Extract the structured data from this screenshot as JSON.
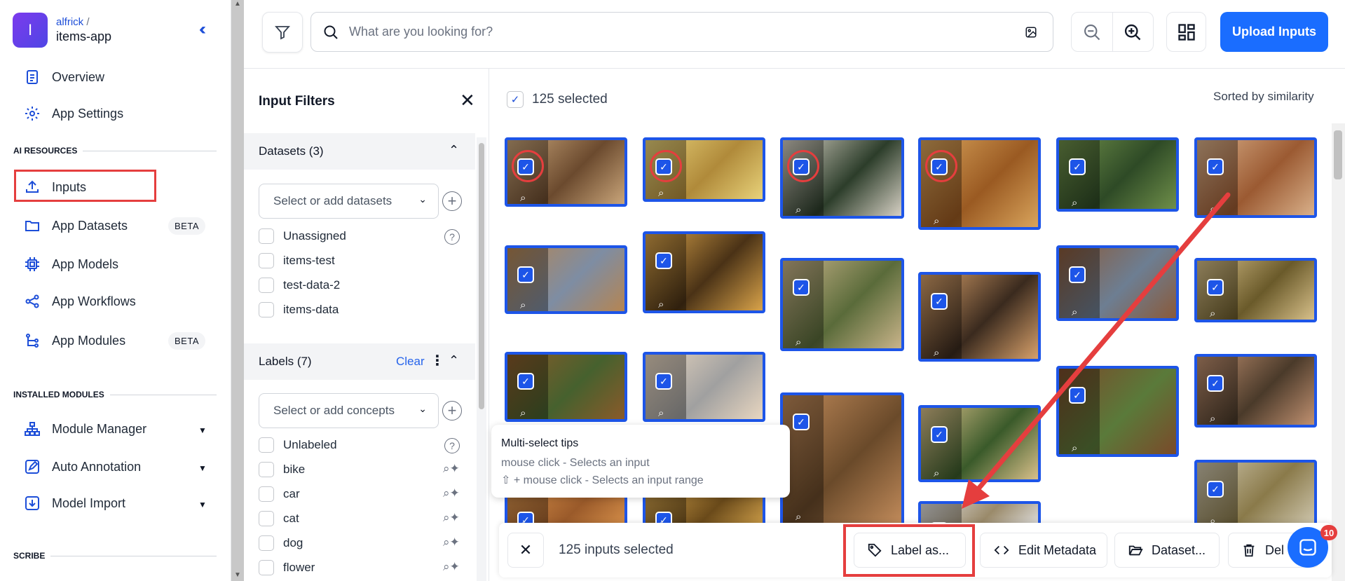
{
  "app": {
    "avatar_letter": "I",
    "user": "alfrick",
    "separator": "/",
    "name": "items-app",
    "collapse_icon": "double-chevron-left-icon"
  },
  "nav": {
    "overview": "Overview",
    "app_settings": "App Settings",
    "ai_resources_heading": "AI RESOURCES",
    "inputs": "Inputs",
    "app_datasets": "App Datasets",
    "app_models": "App Models",
    "app_workflows": "App Workflows",
    "app_modules": "App Modules",
    "beta": "BETA",
    "installed_modules_heading": "INSTALLED MODULES",
    "module_manager": "Module Manager",
    "auto_annotation": "Auto Annotation",
    "model_import": "Model Import",
    "scribe_heading": "SCRIBE"
  },
  "topbar": {
    "search_placeholder": "What are you looking for?",
    "upload_label": "Upload Inputs"
  },
  "filters": {
    "title": "Input Filters",
    "datasets_label": "Datasets (3)",
    "datasets_placeholder": "Select or add datasets",
    "datasets": [
      "Unassigned",
      "items-test",
      "test-data-2",
      "items-data"
    ],
    "labels_label": "Labels (7)",
    "labels_clear": "Clear",
    "labels_placeholder": "Select or add concepts",
    "labels": [
      "Unlabeled",
      "bike",
      "car",
      "cat",
      "dog",
      "flower"
    ]
  },
  "main": {
    "selected_text": "125 selected",
    "sort_text": "Sorted by similarity"
  },
  "tooltip": {
    "title": "Multi-select tips",
    "line1": "mouse click - Selects an input",
    "line2": "⇧ + mouse click - Selects an input range"
  },
  "actionbar": {
    "count": "125 inputs selected",
    "label_as": "Label as...",
    "edit_metadata": "Edit Metadata",
    "dataset": "Dataset...",
    "delete": "Del"
  },
  "chat": {
    "badge": "10"
  },
  "colors": {
    "accent": "#1a6dff",
    "tile_border": "#1d55e8",
    "highlight": "#e53e3e"
  }
}
